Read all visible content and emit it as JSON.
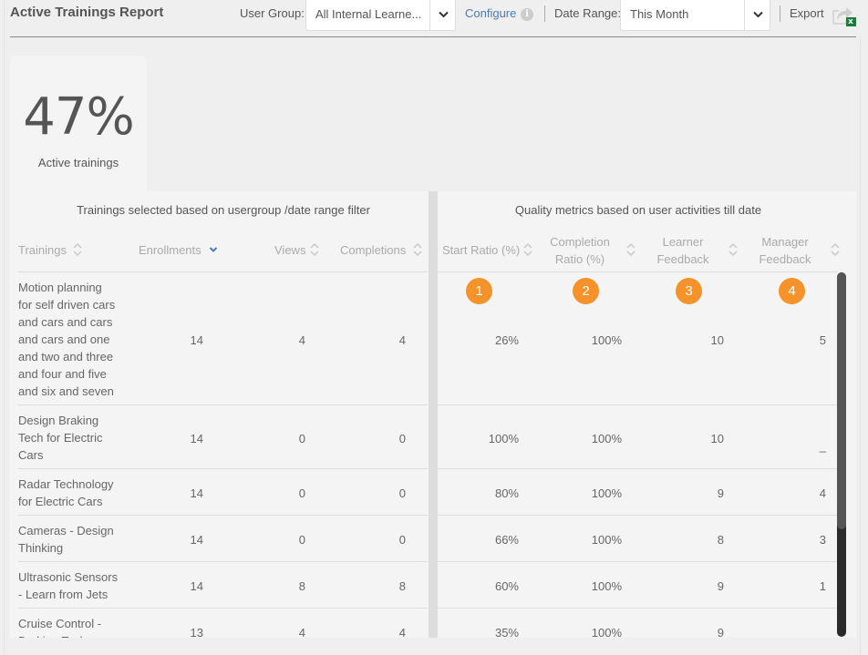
{
  "header": {
    "title": "Active Trainings Report",
    "user_group_label": "User Group:",
    "user_group_value": "All Internal Learne...",
    "configure_label": "Configure",
    "info_icon": "i",
    "date_range_label": "Date Range:",
    "date_range_value": "This Month",
    "export_label": "Export",
    "export_badge": "x"
  },
  "kpi": {
    "value": "47%",
    "label": "Active trainings"
  },
  "table": {
    "left_group_title": "Trainings selected based on usergroup /date range filter",
    "right_group_title": "Quality metrics based on user activities till date",
    "columns": {
      "trainings": "Trainings",
      "enrollments": "Enrollments",
      "views": "Views",
      "completions": "Completions",
      "start_ratio": "Start Ratio (%)",
      "completion_ratio_1": "Completion",
      "completion_ratio_2": "Ratio (%)",
      "learner_feedback_1": "Learner",
      "learner_feedback_2": "Feedback",
      "manager_feedback_1": "Manager",
      "manager_feedback_2": "Feedback"
    },
    "sort_state": {
      "active_column": "enrollments",
      "direction": "descending"
    },
    "badges": [
      "1",
      "2",
      "3",
      "4"
    ],
    "accent_color": "#f5922a",
    "rows": [
      {
        "name_lines": [
          "Motion planning",
          "for self driven cars",
          "and cars and cars",
          "and cars and one",
          "and two and three",
          "and four and five",
          "and six and seven"
        ],
        "enrollments": "14",
        "views": "4",
        "completions": "4",
        "start_ratio": "26%",
        "completion_ratio": "100%",
        "learner_feedback": "10",
        "manager_feedback": "5"
      },
      {
        "name_lines": [
          "Design Braking",
          "Tech for Electric",
          "Cars"
        ],
        "enrollments": "14",
        "views": "0",
        "completions": "0",
        "start_ratio": "100%",
        "completion_ratio": "100%",
        "learner_feedback": "10",
        "manager_feedback": "_"
      },
      {
        "name_lines": [
          "Radar Technology",
          "for Electric Cars"
        ],
        "enrollments": "14",
        "views": "0",
        "completions": "0",
        "start_ratio": "80%",
        "completion_ratio": "100%",
        "learner_feedback": "9",
        "manager_feedback": "4"
      },
      {
        "name_lines": [
          "Cameras - Design",
          "Thinking"
        ],
        "enrollments": "14",
        "views": "0",
        "completions": "0",
        "start_ratio": "66%",
        "completion_ratio": "100%",
        "learner_feedback": "8",
        "manager_feedback": "3"
      },
      {
        "name_lines": [
          "Ultrasonic Sensors",
          "- Learn from Jets"
        ],
        "enrollments": "14",
        "views": "8",
        "completions": "8",
        "start_ratio": "60%",
        "completion_ratio": "100%",
        "learner_feedback": "9",
        "manager_feedback": "1"
      },
      {
        "name_lines": [
          "Cruise Control -",
          "Braking Tech"
        ],
        "enrollments": "13",
        "views": "4",
        "completions": "4",
        "start_ratio": "35%",
        "completion_ratio": "100%",
        "learner_feedback": "9",
        "manager_feedback": "_"
      }
    ]
  }
}
